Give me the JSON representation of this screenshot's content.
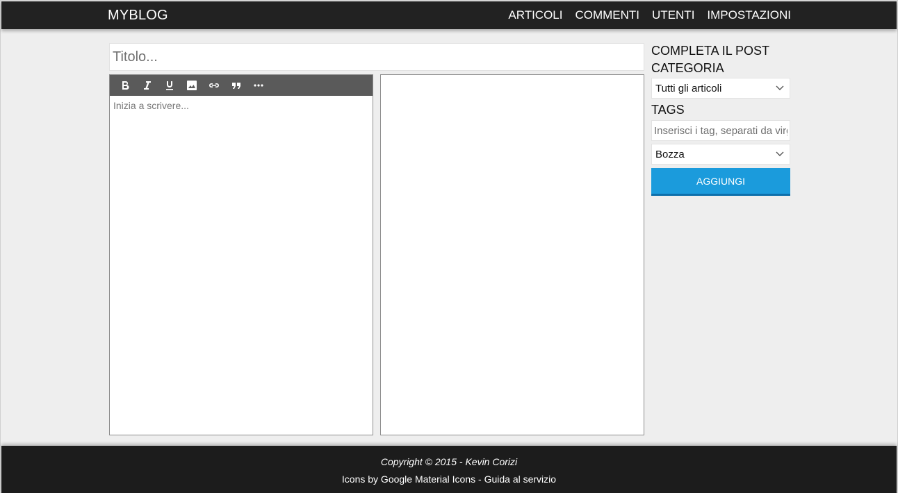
{
  "navbar": {
    "brand": "MYBLOG",
    "links": [
      "ARTICOLI",
      "COMMENTI",
      "UTENTI",
      "IMPOSTAZIONI"
    ]
  },
  "editor": {
    "title_placeholder": "Titolo...",
    "body_placeholder": "Inizia a scrivere...",
    "toolbar": [
      "bold-icon",
      "italic-icon",
      "underline-icon",
      "image-icon",
      "link-icon",
      "quote-icon",
      "more-icon"
    ]
  },
  "sidebar": {
    "heading": "COMPLETA IL POST",
    "category_label": "CATEGORIA",
    "category_value": "Tutti gli articoli",
    "tags_label": "TAGS",
    "tags_placeholder": "Inserisci i tag, separati da virgola",
    "status_value": "Bozza",
    "add_button": "AGGIUNGI"
  },
  "footer": {
    "copyright": "Copyright © 2015 - Kevin Corizi",
    "icons_credit": "Icons by Google Material Icons",
    "separator": " - ",
    "guide_link": "Guida al servizio"
  },
  "colors": {
    "navbar_bg": "#222222",
    "footer_bg": "#1c1c1c",
    "page_bg": "#eeeeee",
    "toolbar_bg": "#5a5a5a",
    "accent": "#1b9bdc"
  }
}
